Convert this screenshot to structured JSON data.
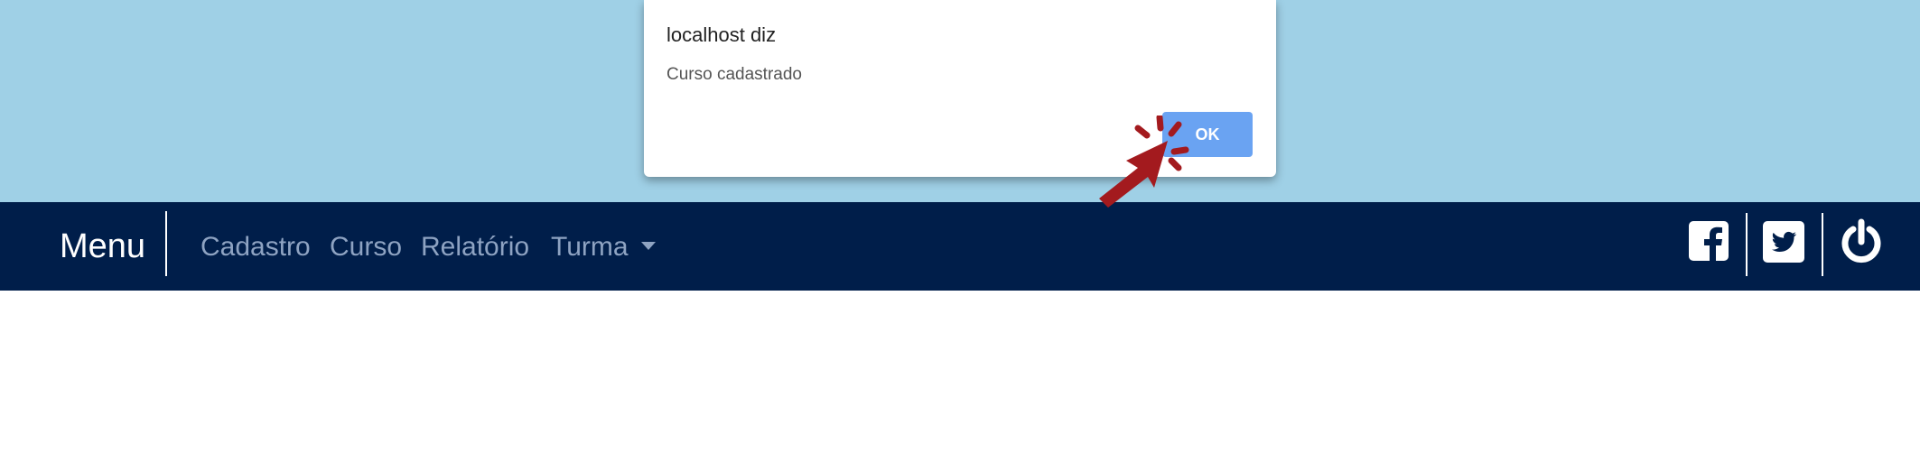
{
  "dialog": {
    "title": "localhost diz",
    "message": "Curso cadastrado",
    "ok_label": "OK"
  },
  "navbar": {
    "brand": "Menu",
    "links": [
      {
        "label": "Cadastro"
      },
      {
        "label": "Curso"
      },
      {
        "label": "Relatório"
      },
      {
        "label": "Turma"
      }
    ],
    "icons": [
      "facebook-icon",
      "twitter-icon",
      "power-icon"
    ]
  },
  "colors": {
    "background_top": "#9fd0e6",
    "navbar": "#001e4a",
    "nav_link": "#8ea3c2",
    "ok_button": "#6aa3f2",
    "cursor_annotation": "#a31a1e"
  }
}
